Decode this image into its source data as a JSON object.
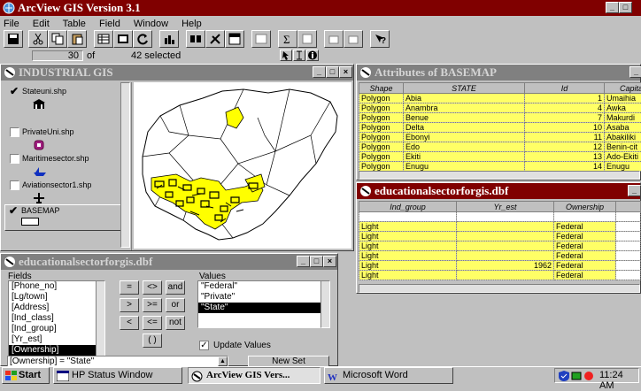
{
  "app": {
    "title": "ArcView GIS Version 3.1"
  },
  "menu": [
    "File",
    "Edit",
    "Table",
    "Field",
    "Window",
    "Help"
  ],
  "status": {
    "record": "30",
    "of_label": "of",
    "selected": "42 selected"
  },
  "view_window": {
    "title": "INDUSTRIAL GIS",
    "themes": [
      {
        "name": "Stateuni.shp",
        "checked": true,
        "symbol": "building-icon"
      },
      {
        "name": "PrivateUni.shp",
        "checked": false,
        "symbol": "purple-shield-icon"
      },
      {
        "name": "Maritimesector.shp",
        "checked": false,
        "symbol": "ship-icon"
      },
      {
        "name": "Aviationsector1.shp",
        "checked": false,
        "symbol": "airplane-icon"
      },
      {
        "name": "BASEMAP",
        "checked": true,
        "symbol": "white-box"
      }
    ]
  },
  "attr_window": {
    "title": "Attributes of BASEMAP",
    "columns": [
      "Shape",
      "STATE",
      "Id",
      "Capital"
    ],
    "rows": [
      [
        "Polygon",
        "Abia",
        "1",
        "Umaihia"
      ],
      [
        "Polygon",
        "Anambra",
        "4",
        "Awka"
      ],
      [
        "Polygon",
        "Benue",
        "7",
        "Makurdi"
      ],
      [
        "Polygon",
        "Delta",
        "10",
        "Asaba"
      ],
      [
        "Polygon",
        "Ebonyi",
        "11",
        "Abakiliki"
      ],
      [
        "Polygon",
        "Edo",
        "12",
        "Benin-cit"
      ],
      [
        "Polygon",
        "Ekiti",
        "13",
        "Ado-Ekiti"
      ],
      [
        "Polygon",
        "Enugu",
        "14",
        "Enugu"
      ]
    ]
  },
  "edu_window": {
    "title": "educationalsectorforgis.dbf",
    "columns": [
      "Ind_group",
      "Yr_est",
      "Ownership"
    ],
    "rows": [
      [
        "",
        "",
        ""
      ],
      [
        "Light",
        "",
        "Federal"
      ],
      [
        "Light",
        "",
        "Federal"
      ],
      [
        "Light",
        "",
        "Federal"
      ],
      [
        "Light",
        "",
        "Federal"
      ],
      [
        "Light",
        "1962",
        "Federal"
      ],
      [
        "Light",
        "",
        "Federal"
      ]
    ]
  },
  "query_window": {
    "title": "educationalsectorforgis.dbf",
    "fields_label": "Fields",
    "fields": [
      "[Phone_no]",
      "[Lg/town]",
      "[Address]",
      "[Ind_class]",
      "[Ind_group]",
      "[Yr_est]",
      "[Ownership]"
    ],
    "operators": [
      "=",
      "<>",
      "and",
      ">",
      ">=",
      "or",
      "<",
      "<=",
      "not",
      "( )"
    ],
    "values_label": "Values",
    "values": [
      "\"Federal\"",
      "\"Private\"",
      "\"State\""
    ],
    "update_label": "Update Values",
    "expression": "[Ownership] = \"State\"",
    "new_set_label": "New Set"
  },
  "taskbar": {
    "start": "Start",
    "tasks": [
      "HP Status Window",
      "ArcView GIS Vers...",
      "Microsoft Word"
    ],
    "clock": "11:24 AM"
  },
  "colors": {
    "title_active": "#800000",
    "highlight": "#ffff66",
    "map_selected": "#ffff00"
  }
}
